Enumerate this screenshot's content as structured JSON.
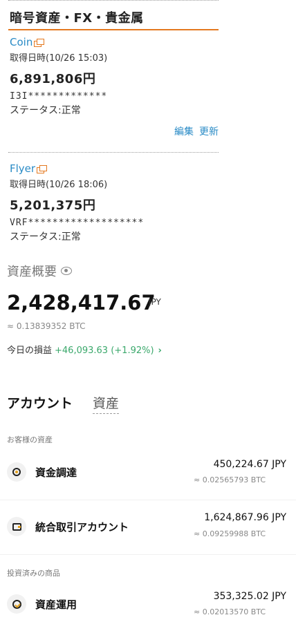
{
  "section": {
    "title": "暗号資産・FX・貴金属"
  },
  "accounts": [
    {
      "name": "Coin",
      "fetched_at": "取得日時(10/26 15:03)",
      "amount": "6,891,806円",
      "masked_id": "I3I*************",
      "status": "ステータス:正常",
      "edit_label": "編集",
      "update_label": "更新"
    },
    {
      "name": "Flyer",
      "fetched_at": "取得日時(10/26 18:06)",
      "amount": "5,201,375円",
      "masked_id": "VRF*******************",
      "status": "ステータス:正常"
    }
  ],
  "overview": {
    "title": "資産概要",
    "total": "2,428,417.67",
    "unit": "JPY",
    "btc_equiv": "≈ 0.13839352 BTC",
    "pnl_label": "今日の損益",
    "pnl_value": "+46,093.63 (+1.92%)",
    "pnl_chevron": "›"
  },
  "tabs": {
    "account": "アカウント",
    "assets": "資産"
  },
  "groups": {
    "customer_assets": "お客様の資産",
    "invested_products": "投資済みの商品"
  },
  "rows": [
    {
      "label": "資金調達",
      "amount": "450,224.67 JPY",
      "btc": "≈ 0.02565793 BTC",
      "icon": "coin-icon"
    },
    {
      "label": "統合取引アカウント",
      "amount": "1,624,867.96 JPY",
      "btc": "≈ 0.09259988 BTC",
      "icon": "wallet-icon"
    },
    {
      "label": "資産運用",
      "amount": "353,325.02 JPY",
      "btc": "≈ 0.02013570 BTC",
      "icon": "earn-icon"
    }
  ],
  "colors": {
    "accent_orange": "#e4781e",
    "link_blue": "#2a8bc6",
    "gain_green": "#3aa86b"
  }
}
